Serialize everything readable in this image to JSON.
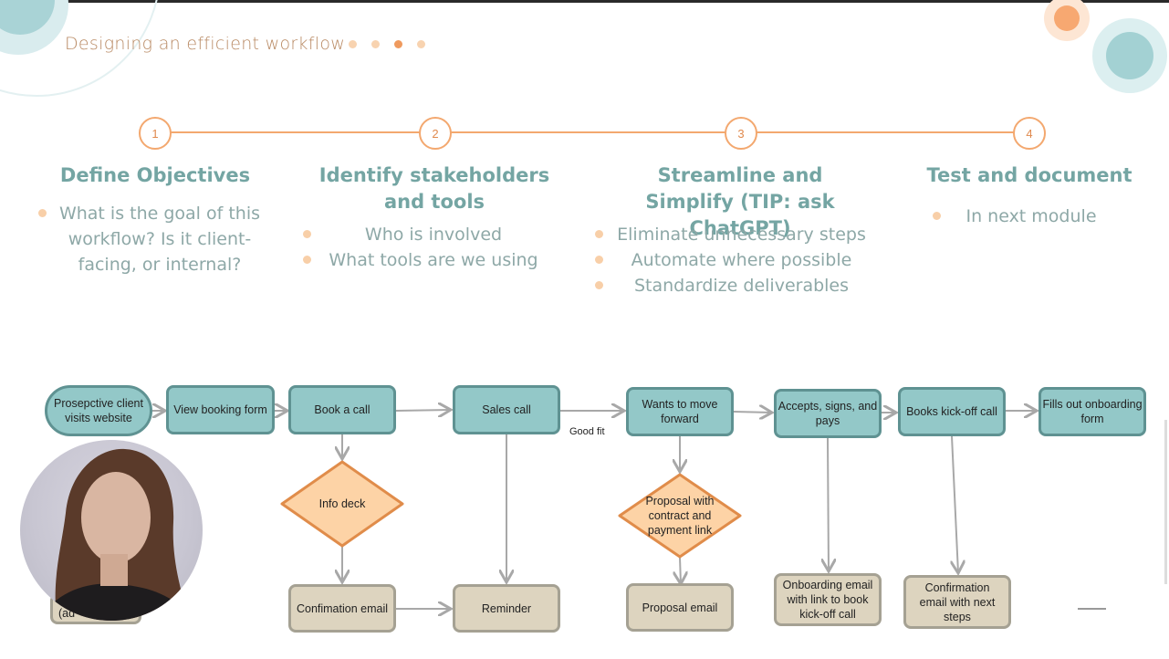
{
  "slide": {
    "title": "Designing an efficient workflow",
    "progress_dots": 4,
    "active_dot": 3,
    "colors": {
      "accent_orange": "#f3a86f",
      "heading_teal": "#74a5a3",
      "box_teal": "#93c8c8",
      "box_tan": "#ddd4bf",
      "diamond_orange": "#fdd3a6"
    }
  },
  "steps": [
    {
      "number": "1",
      "heading": "Define Objectives",
      "bullets": [
        "What is the goal of this workflow? Is it client-facing, or internal?"
      ]
    },
    {
      "number": "2",
      "heading": "Identify stakeholders and tools",
      "bullets": [
        "Who is involved",
        "What tools are we using"
      ]
    },
    {
      "number": "3",
      "heading": "Streamline and Simplify (TIP: ask ChatGPT)",
      "bullets": [
        "Eliminate unnecessary steps",
        "Automate where possible",
        "Standardize deliverables"
      ]
    },
    {
      "number": "4",
      "heading": "Test and document",
      "bullets": [
        "In next module"
      ]
    }
  ],
  "flowchart": {
    "nodes": {
      "prospective": "Prosepctive client visits website",
      "view_form": "View booking form",
      "book_call": "Book a call",
      "sales_call": "Sales call",
      "wants_forward": "Wants to move forward",
      "accepts": "Accepts, signs, and pays",
      "books_kickoff": "Books kick-off call",
      "fills_out": "Fills out onboarding form",
      "info_deck": "Info deck",
      "proposal_contract": "Proposal with contract and payment link",
      "confimation_email": "Confimation email",
      "reminder": "Reminder",
      "proposal_email": "Proposal email",
      "onboarding_email": "Onboarding email with link to book kick-off call",
      "confirmation_next": "Confirmation email with next steps"
    },
    "edge_label_good_fit": "Good fit",
    "hidden_label_fragment": "(ad"
  }
}
